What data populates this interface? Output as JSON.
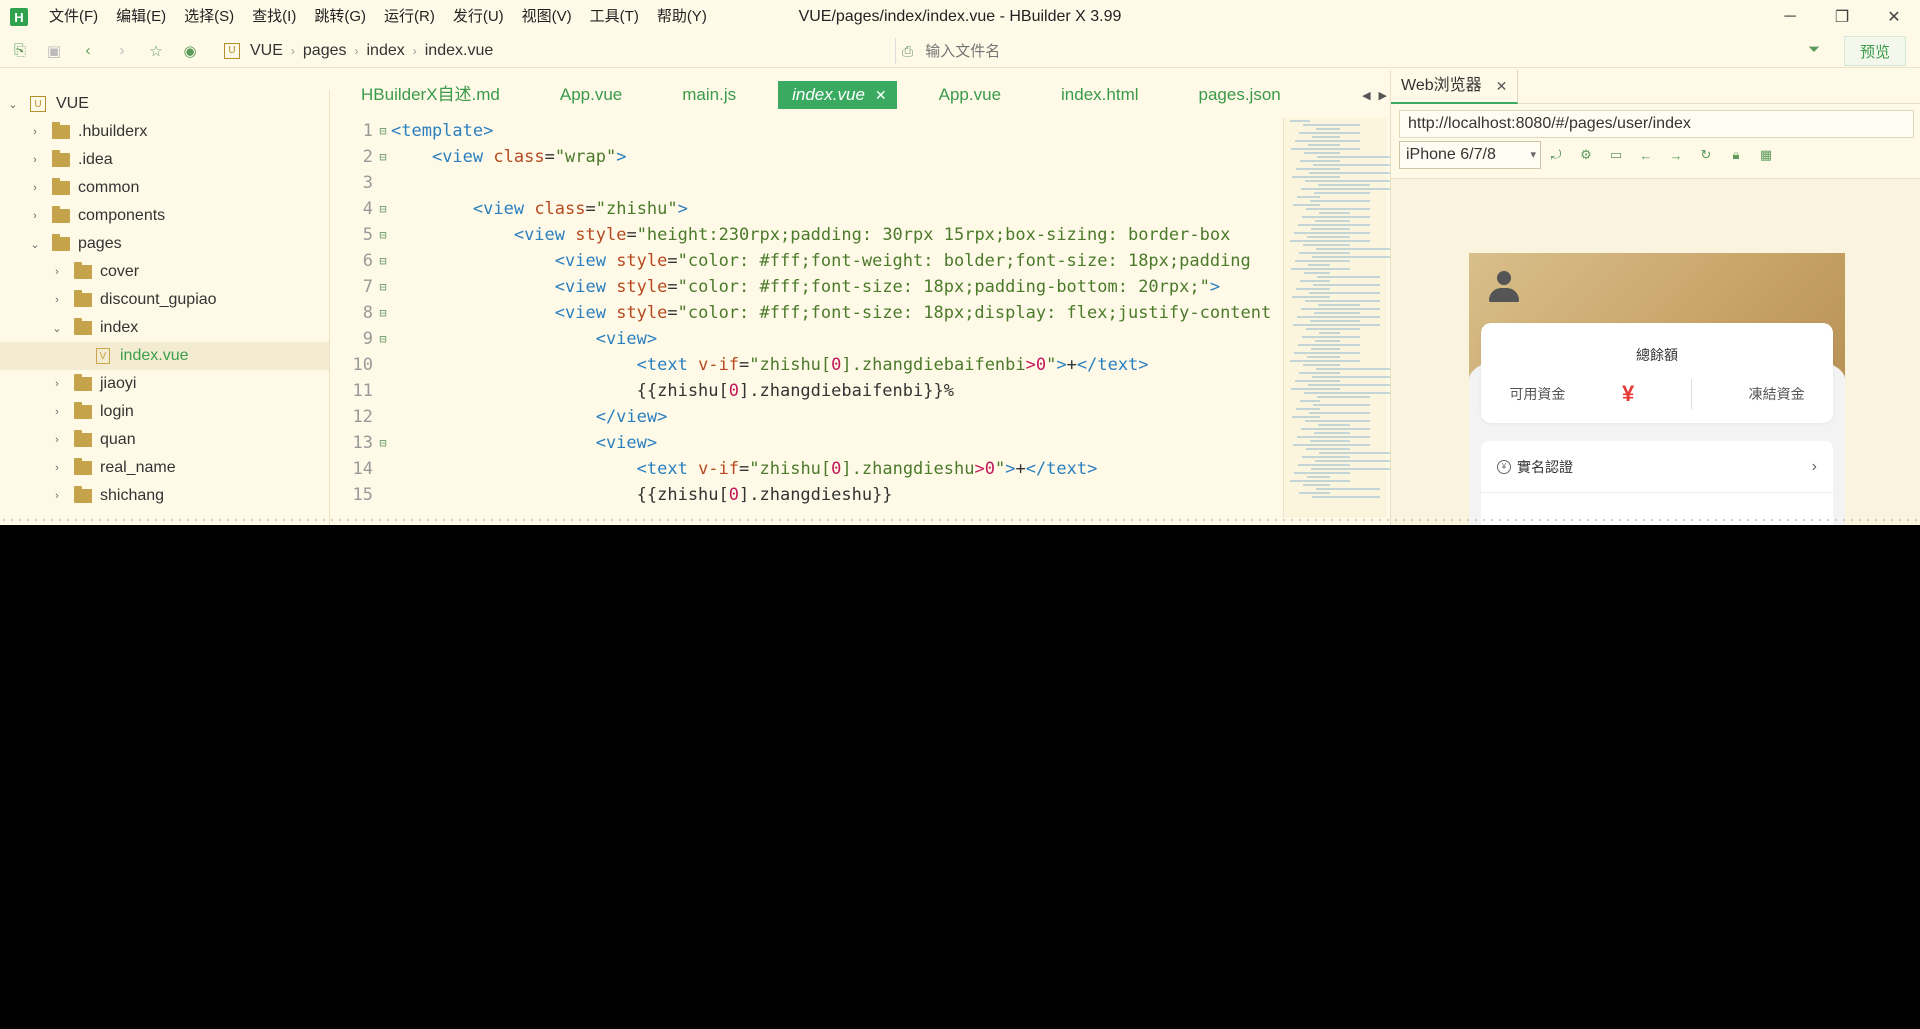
{
  "window": {
    "title": "VUE/pages/index/index.vue - HBuilder X 3.99",
    "logo": "H"
  },
  "menu": [
    "文件(F)",
    "编辑(E)",
    "选择(S)",
    "查找(I)",
    "跳转(G)",
    "运行(R)",
    "发行(U)",
    "视图(V)",
    "工具(T)",
    "帮助(Y)"
  ],
  "breadcrumb": [
    "VUE",
    "pages",
    "index",
    "index.vue"
  ],
  "file_search": {
    "placeholder": "输入文件名"
  },
  "preview_label": "预览",
  "tree": {
    "root": "VUE",
    "items": [
      {
        "label": ".hbuilderx",
        "indent": 1
      },
      {
        "label": ".idea",
        "indent": 1
      },
      {
        "label": "common",
        "indent": 1
      },
      {
        "label": "components",
        "indent": 1
      },
      {
        "label": "pages",
        "indent": 1,
        "open": true
      },
      {
        "label": "cover",
        "indent": 2
      },
      {
        "label": "discount_gupiao",
        "indent": 2
      },
      {
        "label": "index",
        "indent": 2,
        "open": true
      },
      {
        "label": "index.vue",
        "indent": 3,
        "file": true,
        "active": true
      },
      {
        "label": "jiaoyi",
        "indent": 2
      },
      {
        "label": "login",
        "indent": 2
      },
      {
        "label": "quan",
        "indent": 2
      },
      {
        "label": "real_name",
        "indent": 2
      },
      {
        "label": "shichang",
        "indent": 2
      }
    ]
  },
  "tabs": [
    {
      "label": "HBuilderX自述.md"
    },
    {
      "label": "App.vue"
    },
    {
      "label": "main.js"
    },
    {
      "label": "index.vue",
      "active": true
    },
    {
      "label": "App.vue"
    },
    {
      "label": "index.html"
    },
    {
      "label": "pages.json"
    }
  ],
  "code": [
    {
      "n": "1",
      "fold": "⊟",
      "indent": 0,
      "parts": [
        [
          "tag",
          "<template>"
        ]
      ]
    },
    {
      "n": "2",
      "fold": "⊟",
      "indent": 1,
      "parts": [
        [
          "tag",
          "<view "
        ],
        [
          "attr",
          "class"
        ],
        [
          "",
          "="
        ],
        [
          "str",
          "\"wrap\""
        ],
        [
          "tag",
          ">"
        ]
      ]
    },
    {
      "n": "3",
      "fold": "",
      "indent": 0,
      "parts": []
    },
    {
      "n": "4",
      "fold": "⊟",
      "indent": 2,
      "parts": [
        [
          "tag",
          "<view "
        ],
        [
          "attr",
          "class"
        ],
        [
          "",
          "="
        ],
        [
          "str",
          "\"zhishu\""
        ],
        [
          "tag",
          ">"
        ]
      ]
    },
    {
      "n": "5",
      "fold": "⊟",
      "indent": 3,
      "parts": [
        [
          "tag",
          "<view "
        ],
        [
          "attr",
          "style"
        ],
        [
          "",
          "="
        ],
        [
          "str",
          "\"height:230rpx;padding: 30rpx 15rpx;box-sizing: border-box"
        ]
      ]
    },
    {
      "n": "6",
      "fold": "⊟",
      "indent": 4,
      "parts": [
        [
          "tag",
          "<view "
        ],
        [
          "attr",
          "style"
        ],
        [
          "",
          "="
        ],
        [
          "str",
          "\"color: #fff;font-weight: bolder;font-size: 18px;padding"
        ]
      ]
    },
    {
      "n": "7",
      "fold": "⊟",
      "indent": 4,
      "parts": [
        [
          "tag",
          "<view "
        ],
        [
          "attr",
          "style"
        ],
        [
          "",
          "="
        ],
        [
          "str",
          "\"color: #fff;font-size: 18px;padding-bottom: 20rpx;\""
        ],
        [
          "tag",
          ">"
        ]
      ]
    },
    {
      "n": "8",
      "fold": "⊟",
      "indent": 4,
      "parts": [
        [
          "tag",
          "<view "
        ],
        [
          "attr",
          "style"
        ],
        [
          "",
          "="
        ],
        [
          "str",
          "\"color: #fff;font-size: 18px;display: flex;justify-content"
        ]
      ]
    },
    {
      "n": "9",
      "fold": "⊟",
      "indent": 5,
      "parts": [
        [
          "tag",
          "<view>"
        ]
      ]
    },
    {
      "n": "10",
      "fold": "",
      "indent": 6,
      "parts": [
        [
          "tag",
          "<text "
        ],
        [
          "attr",
          "v-if"
        ],
        [
          "",
          "="
        ],
        [
          "str",
          "\"zhishu["
        ],
        [
          "num",
          "0"
        ],
        [
          "str",
          "].zhangdiebaifenbi"
        ],
        [
          "num",
          ">0"
        ],
        [
          "str",
          "\""
        ],
        [
          "tag",
          ">"
        ],
        [
          "",
          "+"
        ],
        [
          "tag",
          "</text>"
        ]
      ]
    },
    {
      "n": "11",
      "fold": "",
      "indent": 6,
      "parts": [
        [
          "",
          "{{zhishu["
        ],
        [
          "num",
          "0"
        ],
        [
          "",
          "].zhangdiebaifenbi}}%"
        ]
      ]
    },
    {
      "n": "12",
      "fold": "",
      "indent": 5,
      "parts": [
        [
          "tag",
          "</view>"
        ]
      ]
    },
    {
      "n": "13",
      "fold": "⊟",
      "indent": 5,
      "parts": [
        [
          "tag",
          "<view>"
        ]
      ]
    },
    {
      "n": "14",
      "fold": "",
      "indent": 6,
      "parts": [
        [
          "tag",
          "<text "
        ],
        [
          "attr",
          "v-if"
        ],
        [
          "",
          "="
        ],
        [
          "str",
          "\"zhishu["
        ],
        [
          "num",
          "0"
        ],
        [
          "str",
          "].zhangdieshu"
        ],
        [
          "num",
          ">0"
        ],
        [
          "str",
          "\""
        ],
        [
          "tag",
          ">"
        ],
        [
          "",
          "+"
        ],
        [
          "tag",
          "</text>"
        ]
      ]
    },
    {
      "n": "15",
      "fold": "",
      "indent": 6,
      "parts": [
        [
          "",
          "{{zhishu["
        ],
        [
          "num",
          "0"
        ],
        [
          "",
          "].zhangdieshu}}"
        ]
      ]
    }
  ],
  "browser": {
    "tab_label": "Web浏览器",
    "url": "http://localhost:8080/#/pages/user/index",
    "device": "iPhone 6/7/8",
    "phone": {
      "card_title": "總餘額",
      "available": "可用資金",
      "currency": "¥",
      "frozen": "凍結資金",
      "list": [
        {
          "label": "實名認證"
        }
      ]
    }
  },
  "colors": {
    "accent": "#3aaa60",
    "background": "#fffae8",
    "gold": "#c9a469"
  }
}
